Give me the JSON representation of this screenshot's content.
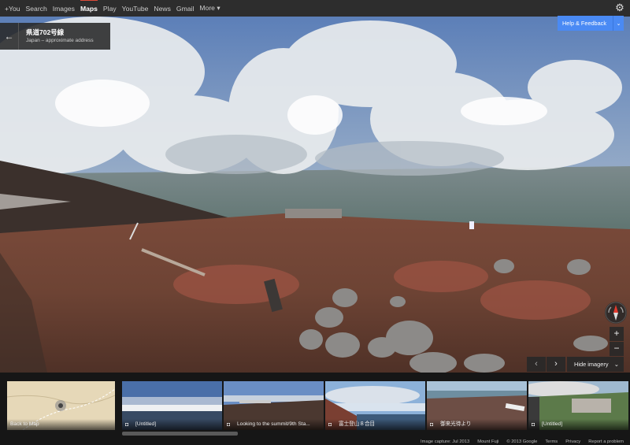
{
  "topbar": {
    "links": [
      "+You",
      "Search",
      "Images",
      "Maps",
      "Play",
      "YouTube",
      "News",
      "Gmail",
      "More ▾"
    ],
    "active": "Maps",
    "settings_icon": "gear-icon"
  },
  "address": {
    "title": "県道702号線",
    "subtitle": "Japan – approximate address",
    "back_icon": "back-arrow-icon"
  },
  "help": {
    "label": "Help & Feedback",
    "chevron": "⌄"
  },
  "controls": {
    "compass_icon": "compass-icon",
    "zoom_in": "+",
    "zoom_out": "−",
    "prev": "‹",
    "next": "›",
    "hide_imagery": "Hide imagery",
    "hide_chevron": "⌄"
  },
  "filmstrip": {
    "back_to_map": "Back to Map",
    "photos": [
      {
        "caption": "[Untitled]"
      },
      {
        "caption": "Looking to the summit/9th Sta..."
      },
      {
        "caption": "富士登山８合目"
      },
      {
        "caption": "御来光待より"
      },
      {
        "caption": "[Untitled]"
      }
    ]
  },
  "footer": {
    "capture": "Image capture: Jul 2013",
    "place": "Mount Fuji",
    "copyright": "© 2013 Google",
    "terms": "Terms",
    "privacy": "Privacy",
    "report": "Report a problem"
  },
  "colors": {
    "accent_blue": "#4a8af4",
    "active_red": "#dd4b39",
    "bar_bg": "#2d2d2d"
  }
}
